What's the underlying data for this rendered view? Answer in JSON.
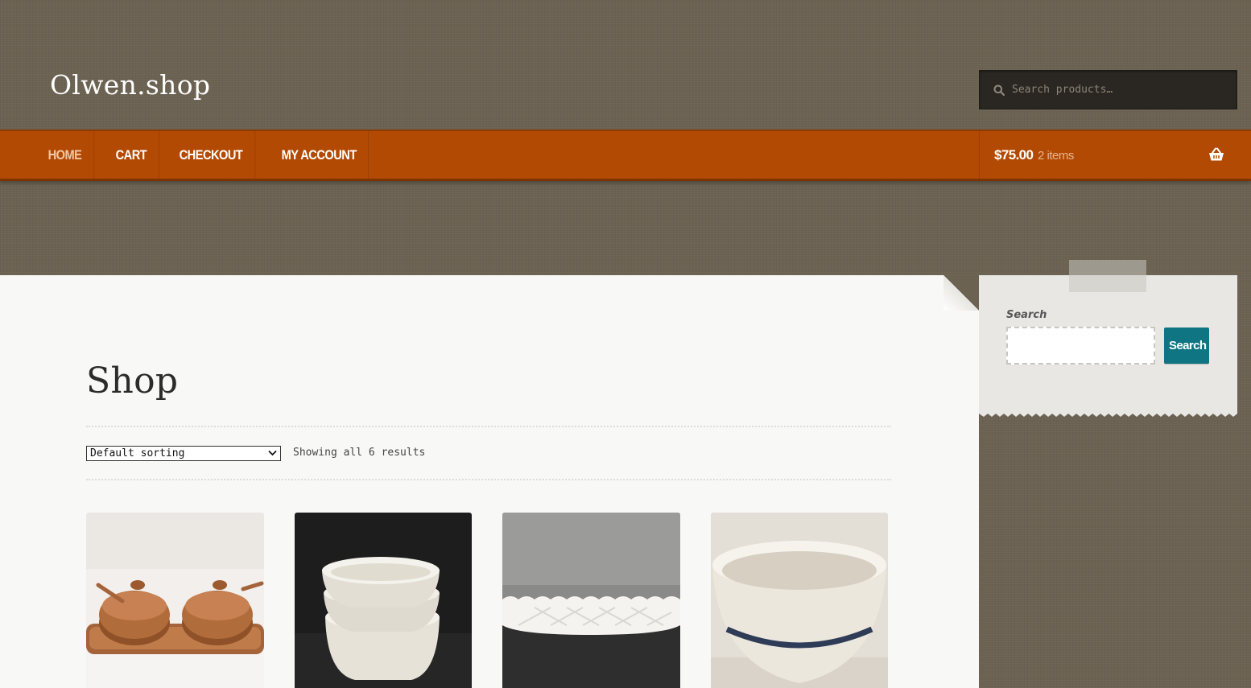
{
  "site": {
    "title": "Olwen.shop"
  },
  "header_search": {
    "placeholder": "Search products…"
  },
  "nav": {
    "items": [
      {
        "label": "HOME",
        "current": true
      },
      {
        "label": "CART"
      },
      {
        "label": "CHECKOUT"
      },
      {
        "label": "MY ACCOUNT"
      }
    ]
  },
  "cart": {
    "amount": "$75.00",
    "count": "2 items",
    "icon": "basket-icon"
  },
  "main": {
    "title": "Shop",
    "sorting": {
      "selected": "Default sorting"
    },
    "results": "Showing all 6 results",
    "products": [
      {
        "name": "product-1",
        "image": "wooden-bowls-with-lids-on-tray"
      },
      {
        "name": "product-2",
        "image": "stacked-white-bowls"
      },
      {
        "name": "product-3",
        "image": "milk-glass-oval-dish"
      },
      {
        "name": "product-4",
        "image": "cream-mixing-bowl-blue-stripe"
      }
    ]
  },
  "sidebar": {
    "search_label": "Search",
    "search_button": "Search"
  },
  "colors": {
    "background": "#6b6252",
    "nav": "#b34a03",
    "button": "#0f7583",
    "content": "#f8f8f7"
  }
}
